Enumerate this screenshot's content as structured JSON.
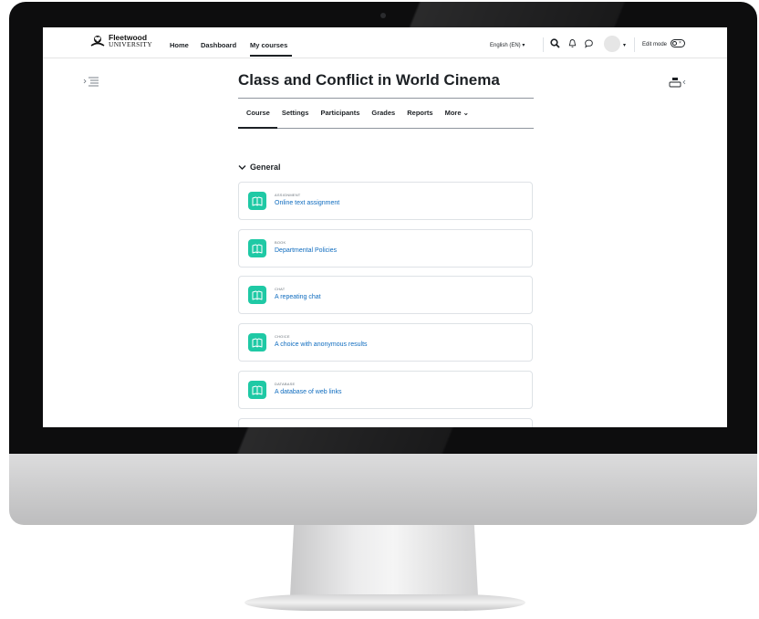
{
  "site": {
    "logo_name": "Fleetwood",
    "logo_sub": "UNIVERSITY"
  },
  "nav": {
    "links": [
      "Home",
      "Dashboard",
      "My courses"
    ],
    "active": "My courses",
    "language": "English (EN) ▾",
    "edit_mode_label": "Edit mode"
  },
  "course": {
    "title": "Class and Conflict in World Cinema",
    "tabs": [
      "Course",
      "Settings",
      "Participants",
      "Grades",
      "Reports",
      "More ⌄"
    ],
    "active_tab": "Course"
  },
  "section": {
    "title": "General",
    "activities": [
      {
        "type": "ASSIGNMENT",
        "name": "Online text assignment"
      },
      {
        "type": "BOOK",
        "name": "Departmental Policies"
      },
      {
        "type": "CHAT",
        "name": "A repeating chat"
      },
      {
        "type": "CHOICE",
        "name": "A choice with anonymous results"
      },
      {
        "type": "DATABASE",
        "name": "A database of web links"
      }
    ]
  },
  "icons": {
    "activity_icon": "book-icon",
    "search": "search-icon",
    "notifications": "bell-icon",
    "messages": "chat-bubble-icon"
  },
  "colors": {
    "accent_teal": "#1fc9a5",
    "link_blue": "#0f6cbf",
    "text_dark": "#1d2125"
  }
}
